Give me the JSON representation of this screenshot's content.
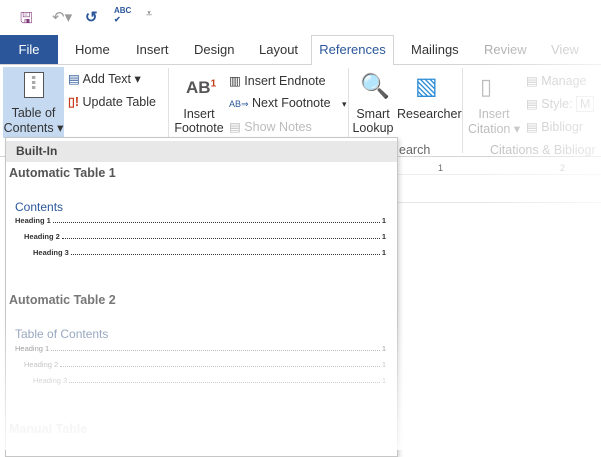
{
  "qat": {
    "icons": [
      "save-icon",
      "undo-icon",
      "redo-icon",
      "spelling-icon",
      "customize-icon"
    ]
  },
  "tabs": {
    "file": "File",
    "home": "Home",
    "insert": "Insert",
    "design": "Design",
    "layout": "Layout",
    "references": "References",
    "mailings": "Mailings",
    "review": "Review",
    "view": "View"
  },
  "ribbon": {
    "toc_line1": "Table of",
    "toc_line2": "Contents ▾",
    "add_text": "Add Text ▾",
    "update_table": "Update Table",
    "insert_footnote_l1": "Insert",
    "insert_footnote_l2": "Footnote",
    "ab_glyph": "AB",
    "ab_sup": "1",
    "insert_endnote": "Insert Endnote",
    "next_footnote": "Next Footnote",
    "next_dropdown": "▾",
    "show_notes": "Show Notes",
    "smart_l1": "Smart",
    "smart_l2": "Lookup",
    "researcher": "Researcher",
    "research_group": "earch",
    "citation_l1": "Insert",
    "citation_l2": "Citation ▾",
    "manage": "Manage",
    "style": "Style:",
    "style_value": "M",
    "bibliography": "Bibliogr",
    "citations_group": "Citations & Bibliogr"
  },
  "ruler": {
    "n1": "1",
    "n2": "2"
  },
  "dropdown": {
    "header": "Built-In",
    "auto1": {
      "title": "Automatic Table 1",
      "heading": "Contents",
      "rows": [
        {
          "label": "Heading 1",
          "page": "1"
        },
        {
          "label": "Heading 2",
          "page": "1"
        },
        {
          "label": "Heading 3",
          "page": "1"
        }
      ]
    },
    "auto2": {
      "title": "Automatic Table 2",
      "heading": "Table of Contents",
      "rows": [
        {
          "label": "Heading 1",
          "page": "1"
        },
        {
          "label": "Heading 2",
          "page": "1"
        },
        {
          "label": "Heading 3",
          "page": "1"
        }
      ]
    },
    "manual": {
      "title": "Manual Table"
    }
  }
}
